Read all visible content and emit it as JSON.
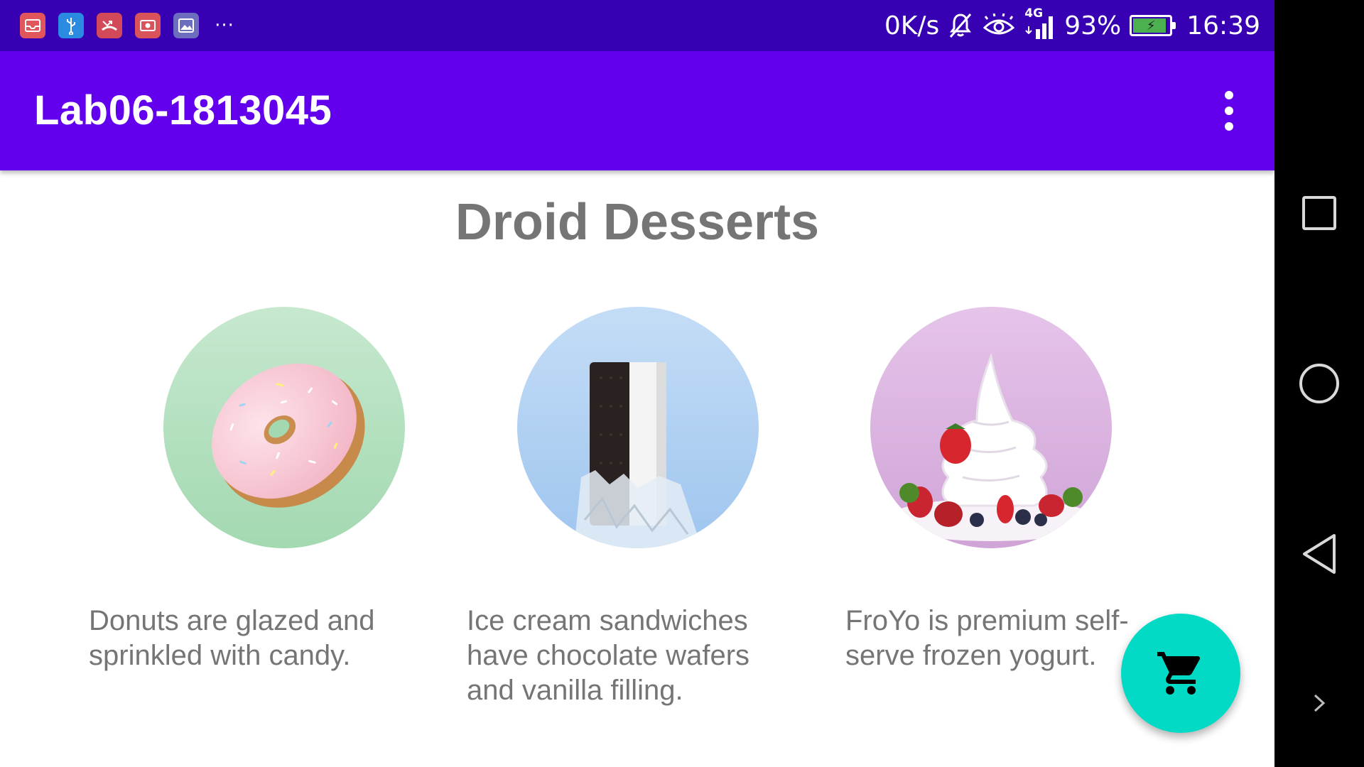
{
  "status_bar": {
    "notifications": [
      {
        "icon": "mail-icon",
        "color": "#e0565b"
      },
      {
        "icon": "usb-icon",
        "color": "#2b8be0"
      },
      {
        "icon": "missed-call-icon",
        "color": "#d24a5a"
      },
      {
        "icon": "screen-record-icon",
        "color": "#d9535b"
      },
      {
        "icon": "gallery-icon",
        "color": "#6d6dbf"
      }
    ],
    "more_icon": "more-icon",
    "network_speed": "0K/s",
    "network_type": "4G",
    "battery_percent": "93%",
    "battery_level": 0.93,
    "time": "16:39"
  },
  "app_bar": {
    "title": "Lab06-1813045",
    "menu_icon": "overflow-menu-icon"
  },
  "main": {
    "heading": "Droid Desserts",
    "desserts": [
      {
        "name": "donut",
        "description": "Donuts are glazed and sprinkled with candy.",
        "bg": [
          "#c6e8cf",
          "#a3d9b1"
        ]
      },
      {
        "name": "ice-cream-sandwich",
        "description": "Ice cream sandwiches have chocolate wafers and vanilla filling.",
        "bg": [
          "#c4ddf6",
          "#9fc5ef"
        ]
      },
      {
        "name": "froyo",
        "description": "FroYo is premium self-serve frozen yogurt.",
        "bg": [
          "#e6c4ea",
          "#cfa4d6"
        ]
      }
    ]
  },
  "fab": {
    "icon": "shopping-cart-icon"
  },
  "colors": {
    "primary": "#6200ee",
    "primary_dark": "#3700b3",
    "accent": "#03dac5",
    "text_secondary": "#757575"
  },
  "nav_bar": {
    "buttons": [
      "recents-icon",
      "home-icon",
      "back-icon",
      "expand-icon"
    ]
  }
}
